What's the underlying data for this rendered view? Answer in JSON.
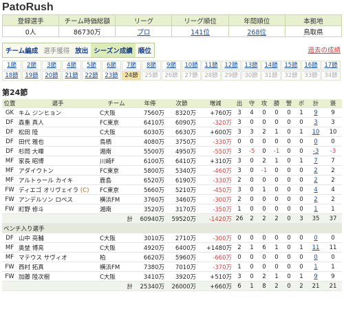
{
  "app_title": "PatoRush",
  "summary": {
    "headers": [
      "登録選手",
      "チーム時価総額",
      "リーグ",
      "リーグ順位",
      "年間順位",
      "本拠地"
    ],
    "values": [
      "0人",
      "86730万",
      "プロ",
      "141位",
      "268位",
      "鳥取県"
    ]
  },
  "menu": {
    "tabs": [
      "チーム編成",
      "選手獲得",
      "放出",
      "シーズン成績",
      "順位"
    ],
    "past_link": "過去の成績"
  },
  "rounds": [
    "1節",
    "2節",
    "3節",
    "4節",
    "5節",
    "6節",
    "7節",
    "8節",
    "9節",
    "10節",
    "11節",
    "12節",
    "13節",
    "14節",
    "15節",
    "16節",
    "17節",
    "18節",
    "19節",
    "20節",
    "21節",
    "22節",
    "23節",
    "24節",
    "25節",
    "26節",
    "27節",
    "28節",
    "29節",
    "30節",
    "31節",
    "32節",
    "33節",
    "34節"
  ],
  "current_round": "24節",
  "section_title": "第24節",
  "columns": [
    "位置",
    "選手",
    "チーム",
    "年俸",
    "次節",
    "増減",
    "出",
    "守",
    "攻",
    "勝",
    "警",
    "ボ",
    "計",
    "褒"
  ],
  "starters": [
    {
      "pos": "GK",
      "name": "キム ジンヒョン",
      "tag": "",
      "team": "C大阪",
      "salary": "7560万",
      "next": "8320万",
      "diff": "+760万",
      "c1": "3",
      "c2": "4",
      "c3": "0",
      "c4": "0",
      "c5": "0",
      "c6": "1",
      "c7": "9",
      "c8": "9"
    },
    {
      "pos": "DF",
      "name": "森重 真人",
      "tag": "",
      "team": "FC東京",
      "salary": "6410万",
      "next": "6090万",
      "diff": "-320万",
      "c1": "3",
      "c2": "0",
      "c3": "0",
      "c4": "0",
      "c5": "0",
      "c6": "0",
      "c7": "3",
      "c8": "3"
    },
    {
      "pos": "DF",
      "name": "松田 陸",
      "tag": "",
      "team": "C大阪",
      "salary": "6030万",
      "next": "6630万",
      "diff": "+600万",
      "c1": "3",
      "c2": "3",
      "c3": "2",
      "c4": "1",
      "c5": "0",
      "c6": "1",
      "c7": "10",
      "c8": "10"
    },
    {
      "pos": "DF",
      "name": "田代 雅也",
      "tag": "",
      "team": "鳥栖",
      "salary": "4080万",
      "next": "3750万",
      "diff": "-330万",
      "c1": "0",
      "c2": "0",
      "c3": "0",
      "c4": "0",
      "c5": "0",
      "c6": "0",
      "c7": "0",
      "c8": "0"
    },
    {
      "pos": "DF",
      "name": "杉岡 大暉",
      "tag": "",
      "team": "湘南",
      "salary": "5500万",
      "next": "4950万",
      "diff": "-550万",
      "c1": "3",
      "c2": "-5",
      "c3": "0",
      "c4": "-1",
      "c5": "0",
      "c6": "0",
      "c7": "-3",
      "c8": "-3"
    },
    {
      "pos": "MF",
      "name": "家長 昭博",
      "tag": "",
      "team": "川崎F",
      "salary": "6100万",
      "next": "6410万",
      "diff": "+310万",
      "c1": "3",
      "c2": "0",
      "c3": "2",
      "c4": "1",
      "c5": "0",
      "c6": "1",
      "c7": "7",
      "c8": "7"
    },
    {
      "pos": "MF",
      "name": "アダイウトン",
      "tag": "",
      "team": "FC東京",
      "salary": "5800万",
      "next": "5340万",
      "diff": "-460万",
      "c1": "3",
      "c2": "0",
      "c3": "-1",
      "c4": "0",
      "c5": "0",
      "c6": "0",
      "c7": "2",
      "c8": "2"
    },
    {
      "pos": "MF",
      "name": "アルトゥール カイキ",
      "tag": "",
      "team": "鹿島",
      "salary": "6520万",
      "next": "6190万",
      "diff": "-330万",
      "c1": "2",
      "c2": "0",
      "c3": "0",
      "c4": "0",
      "c5": "0",
      "c6": "0",
      "c7": "2",
      "c8": "2"
    },
    {
      "pos": "FW",
      "name": "ディエゴ オリヴェイラ",
      "tag": "(C)",
      "team": "FC東京",
      "salary": "5660万",
      "next": "5210万",
      "diff": "-450万",
      "c1": "3",
      "c2": "0",
      "c3": "1",
      "c4": "0",
      "c5": "0",
      "c6": "0",
      "c7": "4",
      "c8": "4"
    },
    {
      "pos": "FW",
      "name": "アンデルソン ロペス",
      "tag": "",
      "team": "横浜FM",
      "salary": "3760万",
      "next": "3460万",
      "diff": "-300万",
      "c1": "2",
      "c2": "0",
      "c3": "0",
      "c4": "0",
      "c5": "0",
      "c6": "0",
      "c7": "2",
      "c8": "2"
    },
    {
      "pos": "FW",
      "name": "町野 修斗",
      "tag": "",
      "team": "湘南",
      "salary": "3520万",
      "next": "3170万",
      "diff": "-350万",
      "c1": "1",
      "c2": "0",
      "c3": "0",
      "c4": "0",
      "c5": "0",
      "c6": "0",
      "c7": "1",
      "c8": "1"
    }
  ],
  "starters_total": {
    "label": "計",
    "salary": "60940万",
    "next": "59520万",
    "diff": "-1420万",
    "c1": "26",
    "c2": "2",
    "c3": "2",
    "c4": "2",
    "c5": "0",
    "c6": "3",
    "c7": "35",
    "c8": "37"
  },
  "bench_title": "ベンチ入り選手",
  "bench": [
    {
      "pos": "DF",
      "name": "山中 亮輔",
      "tag": "",
      "team": "C大阪",
      "salary": "3010万",
      "next": "2710万",
      "diff": "-300万",
      "c1": "0",
      "c2": "0",
      "c3": "0",
      "c4": "0",
      "c5": "0",
      "c6": "0",
      "c7": "0",
      "c8": "0"
    },
    {
      "pos": "MF",
      "name": "奥埜 博亮",
      "tag": "",
      "team": "C大阪",
      "salary": "4920万",
      "next": "6400万",
      "diff": "+1480万",
      "c1": "2",
      "c2": "1",
      "c3": "6",
      "c4": "1",
      "c5": "0",
      "c6": "1",
      "c7": "11",
      "c8": "11"
    },
    {
      "pos": "MF",
      "name": "マテウス サヴィオ",
      "tag": "",
      "team": "柏",
      "salary": "6620万",
      "next": "5960万",
      "diff": "-660万",
      "c1": "0",
      "c2": "0",
      "c3": "0",
      "c4": "0",
      "c5": "0",
      "c6": "0",
      "c7": "0",
      "c8": "0"
    },
    {
      "pos": "FW",
      "name": "西村 拓真",
      "tag": "",
      "team": "横浜FM",
      "salary": "7380万",
      "next": "7010万",
      "diff": "-370万",
      "c1": "1",
      "c2": "0",
      "c3": "0",
      "c4": "0",
      "c5": "0",
      "c6": "0",
      "c7": "1",
      "c8": "1"
    },
    {
      "pos": "FW",
      "name": "加藤 陸次樹",
      "tag": "",
      "team": "C大阪",
      "salary": "3410万",
      "next": "3920万",
      "diff": "+510万",
      "c1": "3",
      "c2": "0",
      "c3": "2",
      "c4": "1",
      "c5": "0",
      "c6": "1",
      "c7": "9",
      "c8": "9"
    }
  ],
  "bench_total": {
    "label": "計",
    "salary": "25340万",
    "next": "26000万",
    "diff": "+660万",
    "c1": "6",
    "c2": "1",
    "c3": "8",
    "c4": "2",
    "c5": "0",
    "c6": "2",
    "c7": "21",
    "c8": "21"
  },
  "colors": {
    "header_bg": "#e8f0d0",
    "link": "#1a4fa0",
    "negative": "#d43f3f",
    "current_round": "#f3e3a8"
  }
}
